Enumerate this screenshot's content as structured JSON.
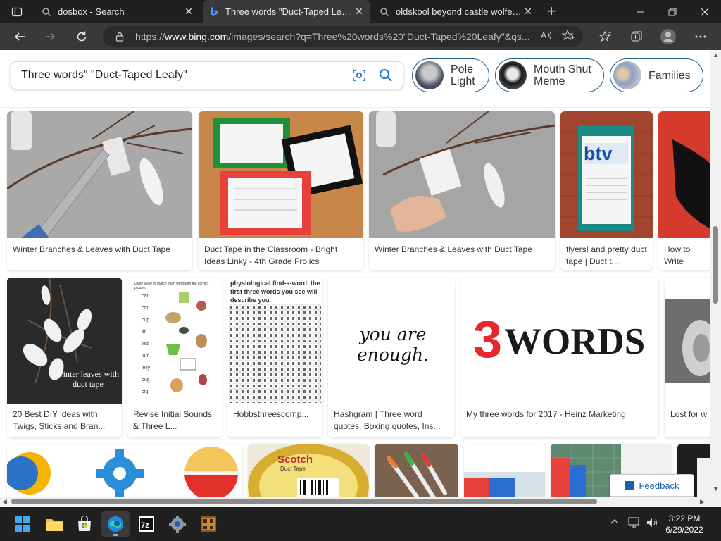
{
  "browser": {
    "tabs": [
      {
        "title": "dosbox - Search",
        "active": false
      },
      {
        "title": "Three words \"Duct-Taped Leafy\"",
        "active": true
      },
      {
        "title": "oldskool beyond castle wolfenste",
        "active": false
      }
    ],
    "url_prefix": "https://",
    "url_host": "www.bing.com",
    "url_rest": "/images/search?q=Three%20words%20\"Duct-Taped%20Leafy\"&qs..."
  },
  "search": {
    "query": "Three words\" \"Duct-Taped Leafy\""
  },
  "chips": [
    {
      "label_line1": "Pole",
      "label_line2": "Light"
    },
    {
      "label_line1": "Mouth Shut",
      "label_line2": "Meme"
    },
    {
      "label_line1": "Families",
      "label_line2": ""
    }
  ],
  "results": {
    "row1": [
      {
        "caption": "Winter Branches & Leaves with Duct Tape"
      },
      {
        "caption": "Duct Tape in the Classroom - Bright Ideas Linky - 4th Grade Frolics"
      },
      {
        "caption": "Winter Branches & Leaves with Duct Tape"
      },
      {
        "caption": "flyers! and pretty duct tape | Duct t..."
      },
      {
        "caption": "How to Write Instructable"
      }
    ],
    "row2": [
      {
        "caption": "20 Best DIY ideas with Twigs, Sticks and Bran...",
        "img_text": "winter leaves with duct tape"
      },
      {
        "caption": "Revise Initial Sounds & Three L...",
        "img_text": "Draw a line to match each word with the correct picture."
      },
      {
        "caption": "Hobbsthreescomp...",
        "img_text": "physiological find-a-word. the first three words you see will describe you."
      },
      {
        "caption": "Hashgram | Three word quotes, Boxing quotes, Ins...",
        "img_text": "you are enough."
      },
      {
        "caption": "My three words for 2017 - Heinz Marketing",
        "img_text_num": "3",
        "img_text_word": "WORDS"
      },
      {
        "caption": "Lost for w"
      }
    ],
    "row3_texts": {
      "scotch": "Scotch",
      "scotch_sub": "Duct Tape"
    },
    "btv_text": "btv",
    "worksheet_words": [
      "cat",
      "cot",
      "cup",
      "tin",
      "ted",
      "jam",
      "jelly",
      "bug",
      "pig"
    ]
  },
  "feedback_label": "Feedback",
  "taskbar": {
    "time": "3:22 PM",
    "date": "6/29/2022"
  }
}
